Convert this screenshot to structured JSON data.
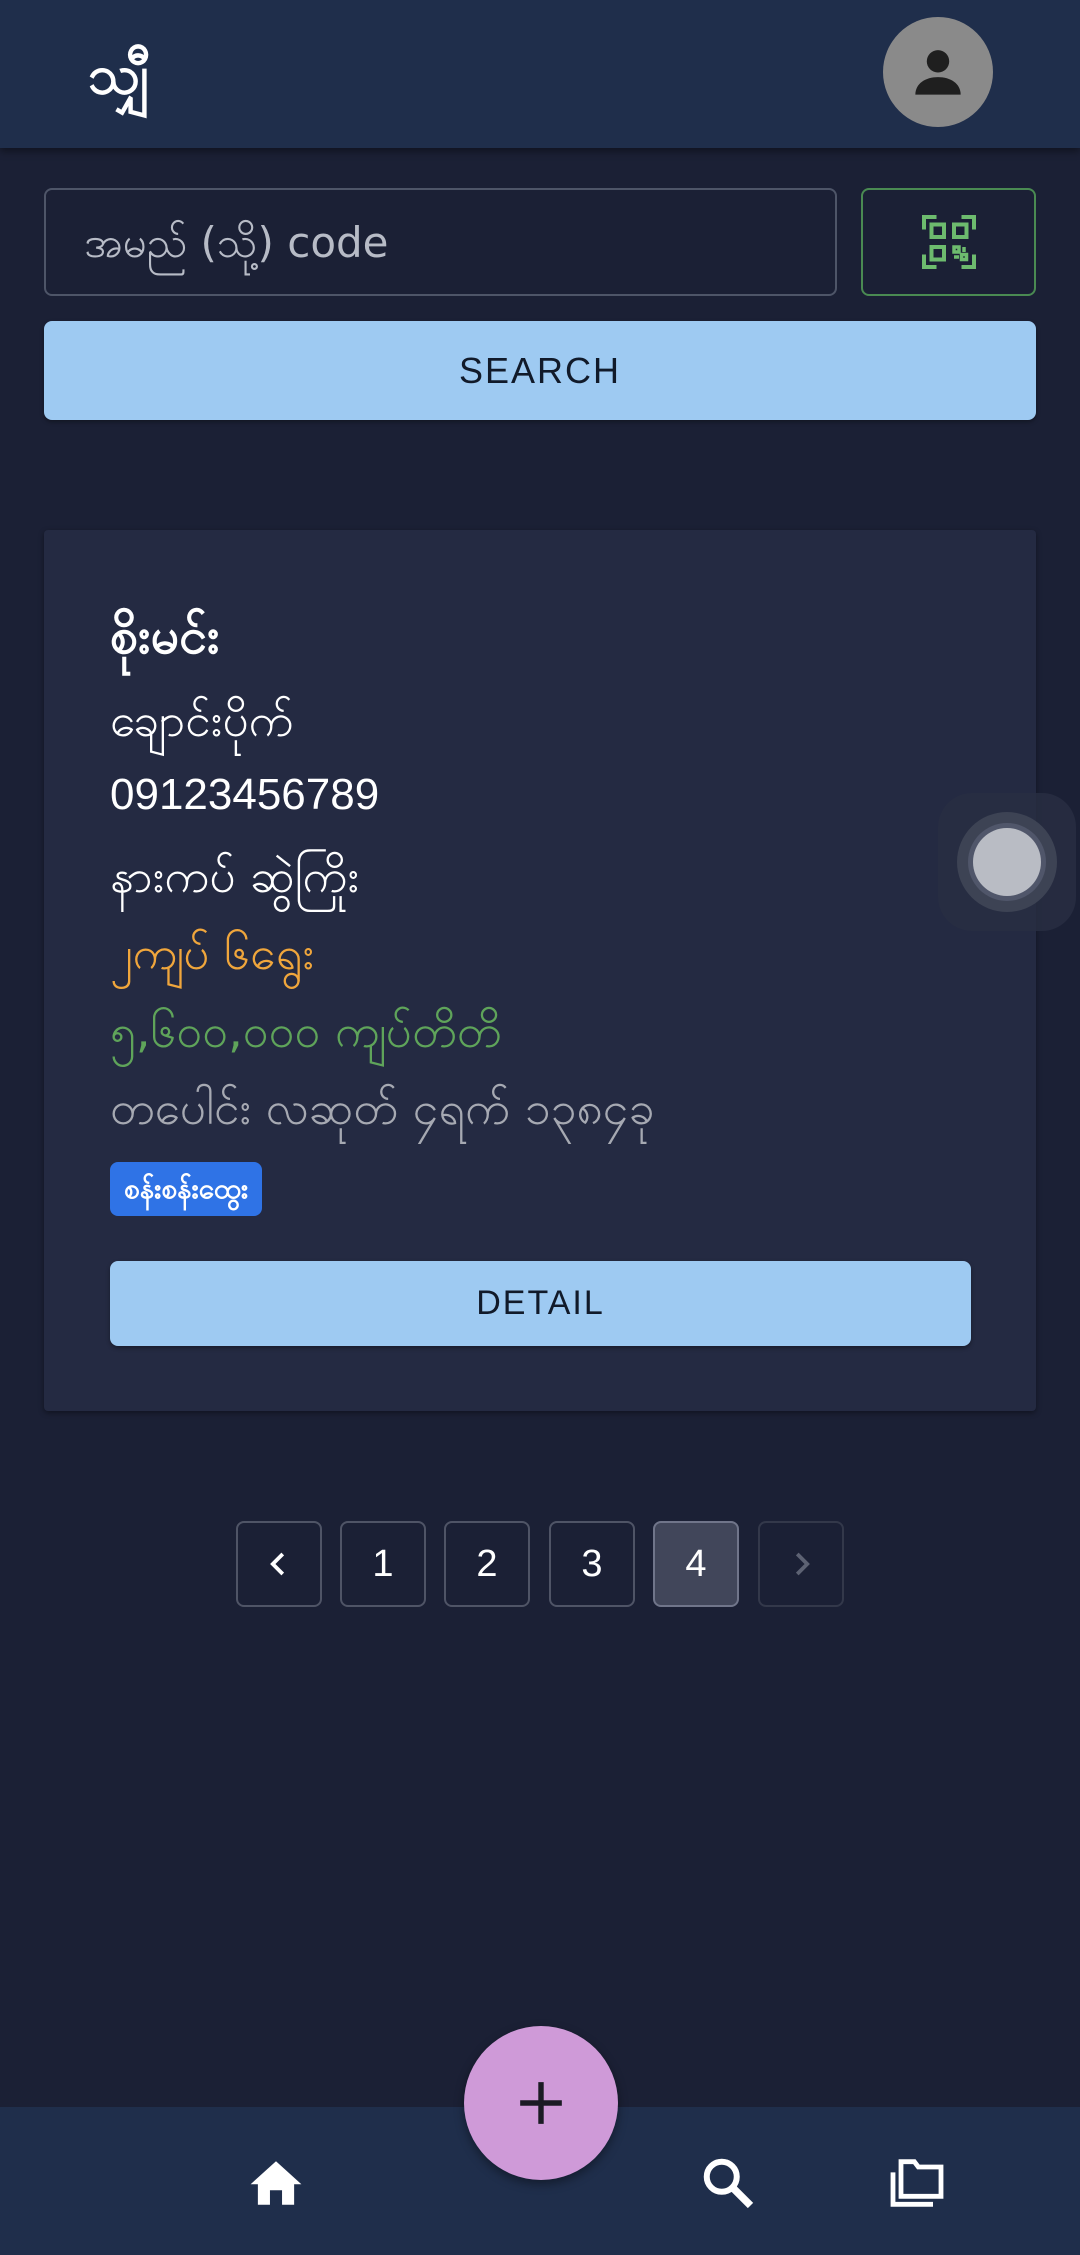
{
  "app": {
    "title": "သျှီ"
  },
  "search": {
    "placeholder": "အမည် (သို့) code",
    "button_label": "SEARCH",
    "qr_icon": "qr-scan-icon"
  },
  "record": {
    "name": "စိုးမင်း",
    "township": "ချောင်းပိုက်",
    "phone": "09123456789",
    "address": "နားကပ် ဆွဲကြိုး",
    "weight": "၂ကျပ် ၆ရွေး",
    "price": "၅,၆၀၀,၀၀၀ ကျပ်တိတိ",
    "date": "တပေါင်း လဆုတ် ၄ရက် ၁၃၈၄ခု",
    "status": "စန်းစန်းထွေး",
    "detail_label": "DETAIL"
  },
  "pagination": {
    "pages": [
      "1",
      "2",
      "3",
      "4"
    ],
    "current": "4"
  },
  "bottom_nav": {
    "items": [
      "home-icon",
      "search-icon",
      "folder-icon"
    ],
    "fab_icon": "plus-icon"
  },
  "colors": {
    "background": "#1b2035",
    "appbar": "#1f2e4b",
    "button": "#9ecaf2",
    "weight_text": "#f0a63c",
    "price_text": "#5fa45a",
    "badge": "#2f73e6",
    "fab": "#cf9ad8"
  }
}
